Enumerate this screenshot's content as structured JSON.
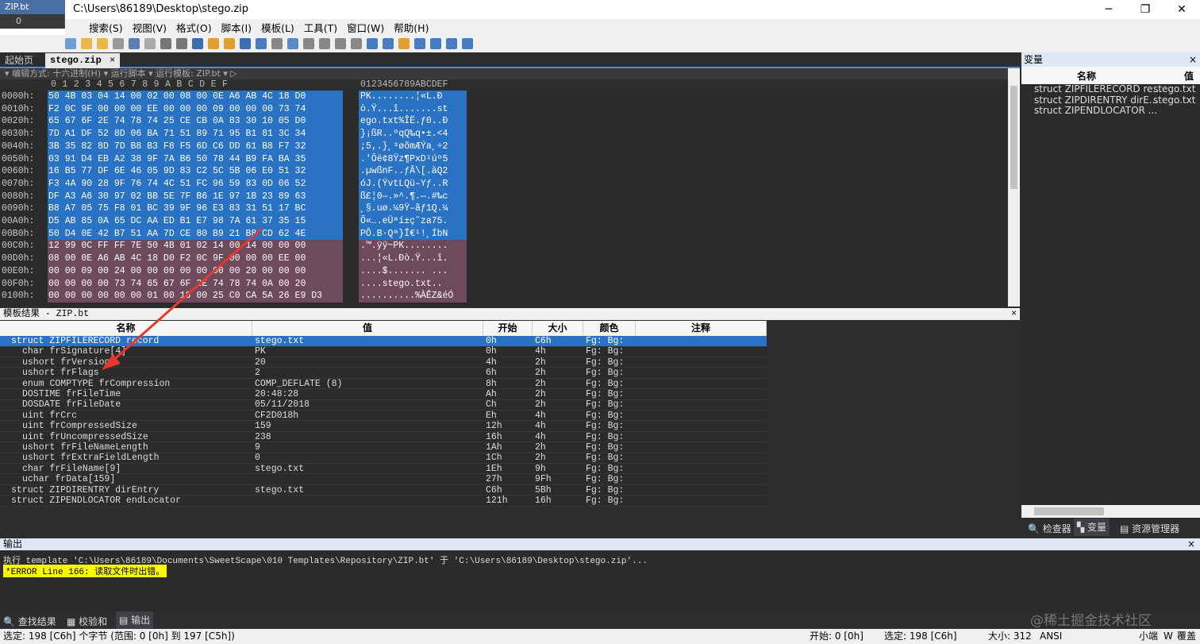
{
  "window": {
    "title": "C:\\Users\\86189\\Desktop\\stego.zip",
    "min": "─",
    "max": "❐",
    "close": "✕"
  },
  "left_panel": {
    "label": "ZIP.bt",
    "idx": "0"
  },
  "menu": [
    "搜索(S)",
    "视图(V)",
    "格式(O)",
    "脚本(I)",
    "模板(L)",
    "工具(T)",
    "窗口(W)",
    "帮助(H)"
  ],
  "tabs": {
    "start": "起始页",
    "file": "stego.zip",
    "close": "×"
  },
  "hexinfo": "▾  编辑方式: 十六进制(H) ▾   运行脚本 ▾   运行模板: ZIP.bt ▾  ▷",
  "hex_header": {
    "bytes": "0  1  2  3  4  5  6  7  8  9  A  B  C  D  E  F",
    "ascii": "0123456789ABCDEF"
  },
  "hex_rows": [
    {
      "off": "0000h:",
      "b": "50 4B 03 04 14 00 02 00 08 00 0E A6 AB 4C 18 D0",
      "a": "PK........¦«L.Ð"
    },
    {
      "off": "0010h:",
      "b": "F2 0C 9F 00 00 00 EE 00 00 00 09 00 00 00 73 74",
      "a": "ò.Ÿ...î.......st"
    },
    {
      "off": "0020h:",
      "b": "65 67 6F 2E 74 78 74 25 CE CB 0A 83 30 10 05 D0",
      "a": "ego.txt%ÎË.ƒ0..Ð"
    },
    {
      "off": "0030h:",
      "b": "7D A1 DF 52 8D 06 BA 71 51 89 71 95 B1 81 3C 34",
      "a": "}¡ßR..ºqQ‰q•±.<4"
    },
    {
      "off": "0040h:",
      "b": "3B 35 82 8D 7D B8 B3 F8 F5 6D C6 DD 61 B8 F7 32",
      "a": ";5‚.}¸³øõmÆÝa¸÷2"
    },
    {
      "off": "0050h:",
      "b": "03 91 D4 EB A2 38 9F 7A B6 50 78 44 B9 FA BA 35",
      "a": ".'Ôë¢8Ÿz¶PxD¹úº5"
    },
    {
      "off": "0060h:",
      "b": "16 B5 77 DF 6E 46 05 9D 83 C2 5C 5B 06 E0 51 32",
      "a": ".µwßnF..ƒÂ\\[.àQ2"
    },
    {
      "off": "0070h:",
      "b": "F3 4A 90 28 9F 76 74 4C 51 FC 96 59 83 0D 06 52",
      "a": "óJ.(ŸvtLQü–Yƒ..R"
    },
    {
      "off": "0080h:",
      "b": "DF A3 A6 30 97 02 BB 5E 7F B6 1E 97 1B 23 89 63",
      "a": "ß£¦0—.»^.¶.—.#‰c"
    },
    {
      "off": "0090h:",
      "b": "B8 A7 05 75 F8 01 BC 39 9F 96 E3 83 31 51 17 BC",
      "a": "¸§.uø.¼9Ÿ–ãƒ1Q.¼"
    },
    {
      "off": "00A0h:",
      "b": "D5 AB 85 0A 65 DC AA ED B1 E7 98 7A 61 37 35 15",
      "a": "Õ«….eÜªí±ç˜za75."
    },
    {
      "off": "00B0h:",
      "b": "50 D4 0E 42 B7 51 AA 7D CE 80 B9 21 B8 CD 62 4E",
      "a": "PÔ.B·Qª}Î€¹!¸ÍbN"
    },
    {
      "off": "00C0h:",
      "b": "12 99 0C FF FF 7E 50 4B 01 02 14 00 14 00 00 00",
      "a": ".™.ÿÿ~PK........"
    },
    {
      "off": "00D0h:",
      "b": "08 00 0E A6 AB 4C 18 D0 F2 0C 9F 00 00 00 EE 00",
      "a": "...¦«L.Ðò.Ÿ...î."
    },
    {
      "off": "00E0h:",
      "b": "00 00 09 00 24 00 00 00 00 00 00 00 20 00 00 00",
      "a": "....$....... ..."
    },
    {
      "off": "00F0h:",
      "b": "00 00 00 00 73 74 65 67 6F 2E 74 78 74 0A 00 20",
      "a": "....stego.txt.. "
    },
    {
      "off": "0100h:",
      "b": "00 00 00 00 00 00 01 00 18 00 25 C0 CA 5A 26 E9 D3",
      "a": "..........%ÀÊZ&éÓ"
    }
  ],
  "template_results": {
    "title": "模板结果 - ZIP.bt",
    "close": "×",
    "columns": [
      "名称",
      "值",
      "开始",
      "大小",
      "颜色",
      "注释"
    ],
    "rows": [
      {
        "name": "struct ZIPFILERECORD record",
        "value": "stego.txt",
        "start": "0h",
        "size": "C6h",
        "color": "Fg:   Bg:",
        "active": true
      },
      {
        "name": "char frSignature[4]",
        "value": "PK\u0003\u0004",
        "start": "0h",
        "size": "4h",
        "color": "Fg:   Bg:"
      },
      {
        "name": "ushort frVersion",
        "value": "20",
        "start": "4h",
        "size": "2h",
        "color": "Fg:   Bg:"
      },
      {
        "name": "ushort frFlags",
        "value": "2",
        "start": "6h",
        "size": "2h",
        "color": "Fg:   Bg:"
      },
      {
        "name": "enum COMPTYPE frCompression",
        "value": "COMP_DEFLATE (8)",
        "start": "8h",
        "size": "2h",
        "color": "Fg:   Bg:"
      },
      {
        "name": "DOSTIME frFileTime",
        "value": "20:48:28",
        "start": "Ah",
        "size": "2h",
        "color": "Fg:   Bg:"
      },
      {
        "name": "DOSDATE frFileDate",
        "value": "05/11/2018",
        "start": "Ch",
        "size": "2h",
        "color": "Fg:   Bg:"
      },
      {
        "name": "uint frCrc",
        "value": "CF2D018h",
        "start": "Eh",
        "size": "4h",
        "color": "Fg:   Bg:"
      },
      {
        "name": "uint frCompressedSize",
        "value": "159",
        "start": "12h",
        "size": "4h",
        "color": "Fg:   Bg:"
      },
      {
        "name": "uint frUncompressedSize",
        "value": "238",
        "start": "16h",
        "size": "4h",
        "color": "Fg:   Bg:"
      },
      {
        "name": "ushort frFileNameLength",
        "value": "9",
        "start": "1Ah",
        "size": "2h",
        "color": "Fg:   Bg:"
      },
      {
        "name": "ushort frExtraFieldLength",
        "value": "0",
        "start": "1Ch",
        "size": "2h",
        "color": "Fg:   Bg:"
      },
      {
        "name": "char frFileName[9]",
        "value": "stego.txt",
        "start": "1Eh",
        "size": "9h",
        "color": "Fg:   Bg:"
      },
      {
        "name": "uchar frData[159]",
        "value": "",
        "start": "27h",
        "size": "9Fh",
        "color": "Fg:   Bg:"
      },
      {
        "name": "struct ZIPDIRENTRY dirEntry",
        "value": "stego.txt",
        "start": "C6h",
        "size": "5Bh",
        "color": "Fg:   Bg:"
      },
      {
        "name": "struct ZIPENDLOCATOR endLocator",
        "value": "",
        "start": "121h",
        "size": "16h",
        "color": "Fg:   Bg:"
      }
    ]
  },
  "variables": {
    "title": "变量",
    "close": "×",
    "columns": [
      "名称",
      "值"
    ],
    "rows": [
      {
        "name": "struct ZIPFILERECORD re...",
        "value": "stego.txt"
      },
      {
        "name": "struct ZIPDIRENTRY dirE...",
        "value": "stego.txt"
      },
      {
        "name": "struct ZIPENDLOCATOR ...",
        "value": ""
      }
    ],
    "tabs": [
      "检查器",
      "变量",
      "资源管理器"
    ]
  },
  "output": {
    "title": "输出",
    "close": "×",
    "line1": "执行 template 'C:\\Users\\86189\\Documents\\SweetScape\\010 Templates\\Repository\\ZIP.bt' 于 'C:\\Users\\86189\\Desktop\\stego.zip'...",
    "line2": "*ERROR Line 166: 读取文件时出错。"
  },
  "bottom_tabs": [
    "查找结果",
    "校验和",
    "输出"
  ],
  "status": {
    "left": "选定: 198 [C6h] 个字节 (范围: 0 [0h] 到 197 [C5h])",
    "start": "开始: 0 [0h]",
    "sel": "选定: 198 [C6h]",
    "size": "大小: 312",
    "enc": "ANSI",
    "endian": "小端",
    "w": "W",
    "mode": "覆盖"
  },
  "watermark": "@稀土掘金技术社区",
  "colors": {
    "selection": "#2a72c3",
    "highlight": "#6e4a5c",
    "error_bg": "#f8f800",
    "arrow": "#e8382e"
  }
}
